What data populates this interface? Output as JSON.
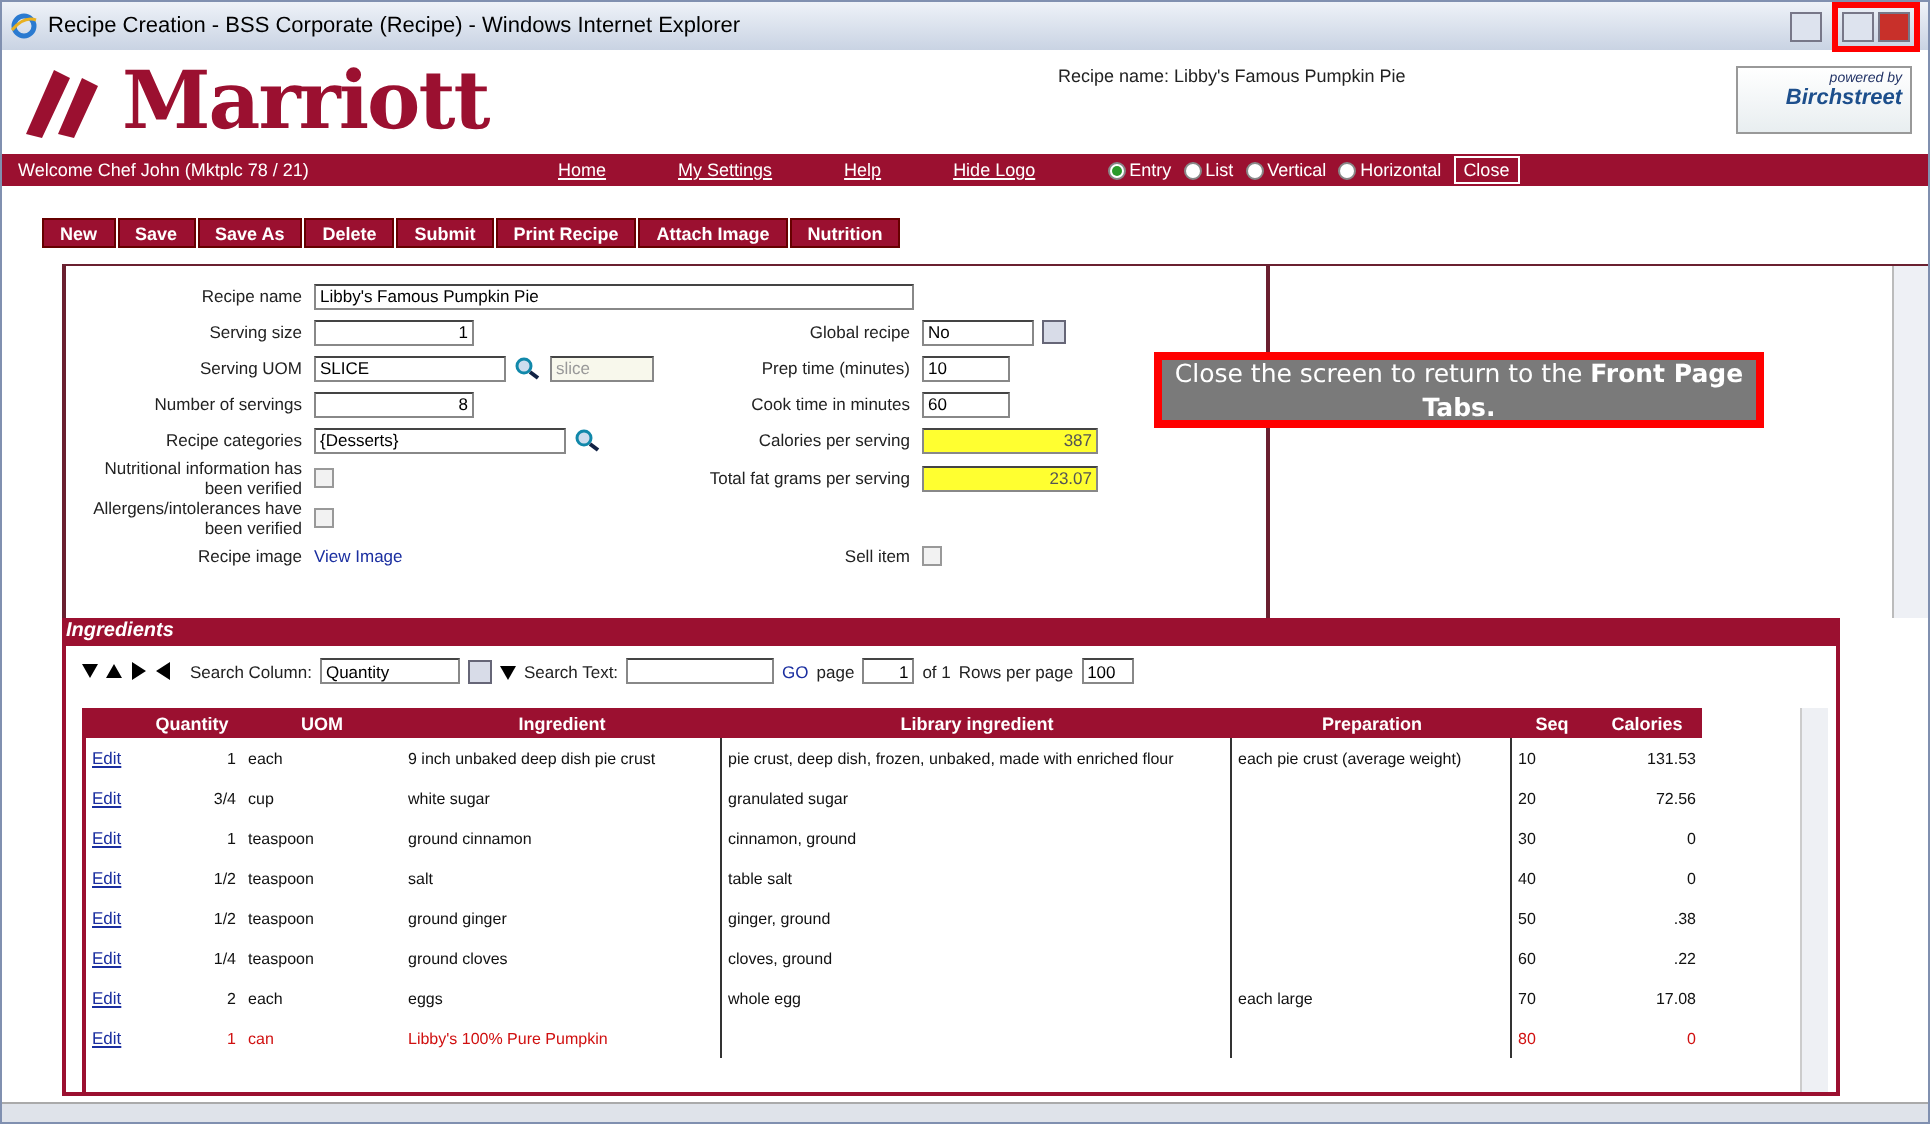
{
  "window": {
    "title": "Recipe Creation - BSS Corporate (Recipe) - Windows Internet Explorer"
  },
  "header": {
    "logo": "Marriott",
    "recipe_name": "Recipe name: Libby's Famous Pumpkin Pie",
    "badge_top": "powered by",
    "badge_brand": "Birchstreet"
  },
  "nav": {
    "welcome": "Welcome Chef John (Mktplc 78 / 21)",
    "links": [
      "Home",
      "My Settings",
      "Help",
      "Hide Logo"
    ],
    "views": [
      {
        "label": "Entry",
        "selected": true
      },
      {
        "label": "List",
        "selected": false
      },
      {
        "label": "Vertical",
        "selected": false
      },
      {
        "label": "Horizontal",
        "selected": false
      }
    ],
    "close": "Close"
  },
  "toolbar": [
    "New",
    "Save",
    "Save As",
    "Delete",
    "Submit",
    "Print Recipe",
    "Attach Image",
    "Nutrition"
  ],
  "form": {
    "rows": [
      {
        "left": {
          "label": "Recipe name",
          "kind": "wide",
          "value": "Libby's Famous Pumpkin Pie"
        }
      },
      {
        "left": {
          "label": "Serving size",
          "kind": "number",
          "value": "1"
        },
        "right": {
          "label": "Global recipe",
          "kind": "select",
          "value": "No"
        }
      },
      {
        "left": {
          "label": "Serving UOM",
          "kind": "lookup",
          "value": "SLICE",
          "extra": "slice"
        },
        "right": {
          "label": "Prep time (minutes)",
          "kind": "text",
          "value": "10"
        }
      },
      {
        "left": {
          "label": "Number of servings",
          "kind": "number",
          "value": "8"
        },
        "right": {
          "label": "Cook time in minutes",
          "kind": "text",
          "value": "60"
        }
      },
      {
        "left": {
          "label": "Recipe categories",
          "kind": "lookup",
          "value": "{Desserts}"
        },
        "right": {
          "label": "Calories per serving",
          "kind": "computed",
          "value": "387"
        }
      },
      {
        "left": {
          "label": "Nutritional information has been verified",
          "kind": "checkbox",
          "checked": false
        },
        "right": {
          "label": "Total fat grams per serving",
          "kind": "computed",
          "value": "23.07"
        }
      },
      {
        "left": {
          "label": "Allergens/intolerances have been verified",
          "kind": "checkbox",
          "checked": false
        }
      },
      {
        "left": {
          "label": "Recipe image",
          "kind": "link",
          "value": "View Image"
        },
        "right": {
          "label": "Sell item",
          "kind": "checkbox",
          "checked": false
        }
      }
    ]
  },
  "ingredients": {
    "title": "Ingredients",
    "search_column_label": "Search Column:",
    "search_column": "Quantity",
    "search_text_label": "Search Text:",
    "go": "GO",
    "page_label": "page",
    "page": "1",
    "of": "of 1",
    "rows_label": "Rows per page",
    "rows_per_page": "100",
    "columns": [
      "Quantity",
      "UOM",
      "Ingredient",
      "Library ingredient",
      "Preparation",
      "Seq",
      "Calories"
    ],
    "rows": [
      {
        "edit": "Edit",
        "cells": [
          "1",
          "each",
          "9 inch unbaked deep dish pie crust",
          "pie crust, deep dish, frozen, unbaked, made with enriched flour",
          "each pie crust (average weight)",
          "10",
          "131.53"
        ],
        "error": false
      },
      {
        "edit": "Edit",
        "cells": [
          "3/4",
          "cup",
          "white sugar",
          "granulated sugar",
          "",
          "20",
          "72.56"
        ],
        "error": false
      },
      {
        "edit": "Edit",
        "cells": [
          "1",
          "teaspoon",
          "ground cinnamon",
          "cinnamon, ground",
          "",
          "30",
          "0"
        ],
        "error": false
      },
      {
        "edit": "Edit",
        "cells": [
          "1/2",
          "teaspoon",
          "salt",
          "table salt",
          "",
          "40",
          "0"
        ],
        "error": false
      },
      {
        "edit": "Edit",
        "cells": [
          "1/2",
          "teaspoon",
          "ground ginger",
          "ginger, ground",
          "",
          "50",
          ".38"
        ],
        "error": false
      },
      {
        "edit": "Edit",
        "cells": [
          "1/4",
          "teaspoon",
          "ground cloves",
          "cloves, ground",
          "",
          "60",
          ".22"
        ],
        "error": false
      },
      {
        "edit": "Edit",
        "cells": [
          "2",
          "each",
          "eggs",
          "whole egg",
          "each large",
          "70",
          "17.08"
        ],
        "error": false
      },
      {
        "edit": "Edit",
        "cells": [
          "1",
          "can",
          "Libby's 100% Pure Pumpkin",
          "",
          "",
          "80",
          "0"
        ],
        "error": true
      }
    ]
  },
  "callout": "Close the screen to return to the **Front Page Tabs.**"
}
